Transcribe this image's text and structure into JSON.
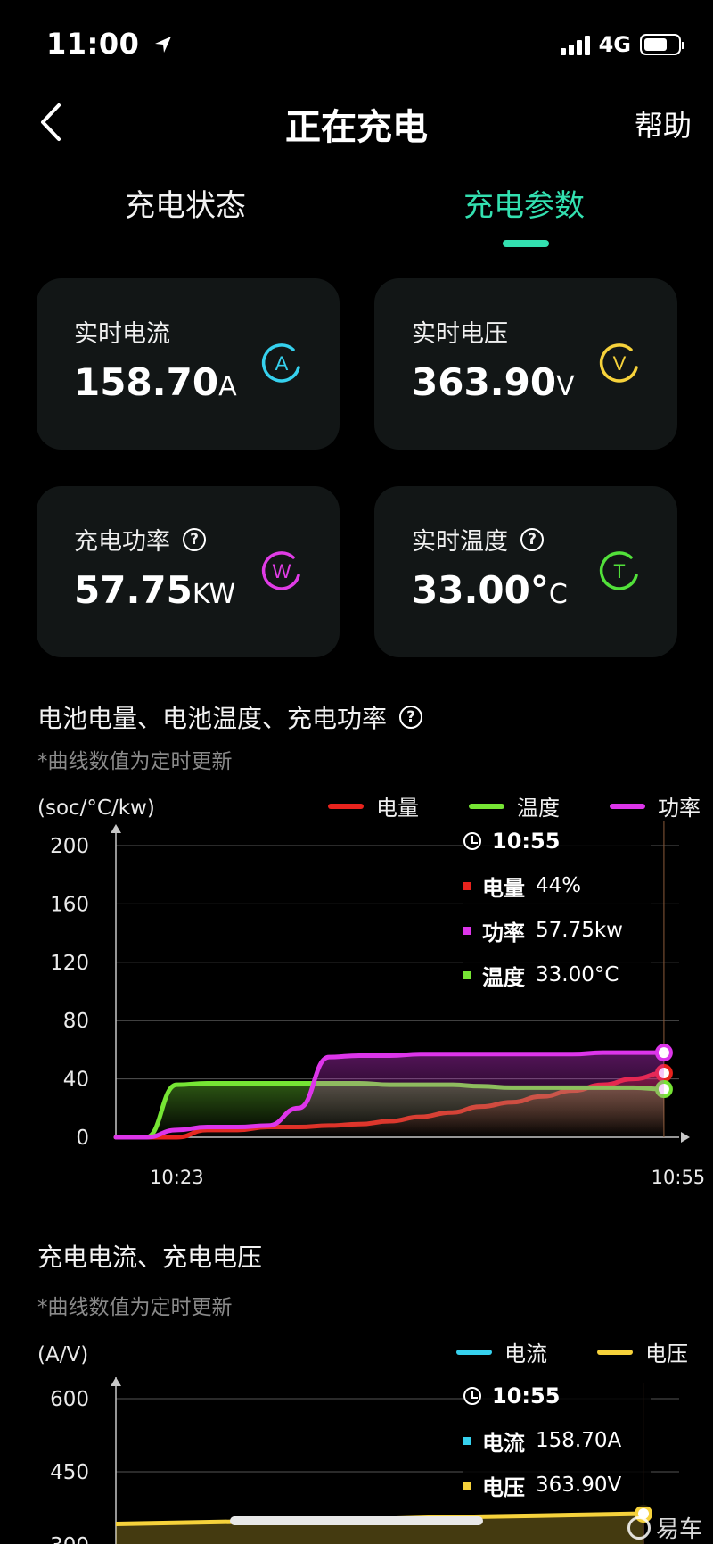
{
  "status_bar": {
    "time": "11:00",
    "network": "4G"
  },
  "nav": {
    "title": "正在充电",
    "help": "帮助"
  },
  "tabs": [
    {
      "label": "充电状态",
      "active": false
    },
    {
      "label": "充电参数",
      "active": true
    }
  ],
  "cards": {
    "current": {
      "label": "实时电流",
      "value": "158.70",
      "unit": "A",
      "icon_letter": "A",
      "icon_color": "#36d1ee"
    },
    "voltage": {
      "label": "实时电压",
      "value": "363.90",
      "unit": "V",
      "icon_letter": "V",
      "icon_color": "#f6d23b"
    },
    "power": {
      "label": "充电功率",
      "value": "57.75",
      "unit": "KW",
      "icon_letter": "W",
      "icon_color": "#e03ce6"
    },
    "temp": {
      "label": "实时温度",
      "value": "33.00°",
      "unit": "C",
      "icon_letter": "T",
      "icon_color": "#52e13a"
    }
  },
  "section1": {
    "title": "电池电量、电池温度、充电功率",
    "note": "*曲线数值为定时更新"
  },
  "section2": {
    "title": "充电电流、充电电压",
    "note": "*曲线数值为定时更新"
  },
  "chart1": {
    "unit_label": "(soc/°C/kw)",
    "legend": [
      {
        "name": "电量",
        "color": "#e8231d"
      },
      {
        "name": "温度",
        "color": "#76e534"
      },
      {
        "name": "功率",
        "color": "#dd35ea"
      }
    ],
    "tooltip": {
      "time": "10:55",
      "rows": [
        {
          "name": "电量",
          "value": "44%",
          "color": "#e8231d"
        },
        {
          "name": "功率",
          "value": "57.75kw",
          "color": "#dd35ea"
        },
        {
          "name": "温度",
          "value": "33.00°C",
          "color": "#76e534"
        }
      ]
    },
    "x_tick_labels": [
      "10:23",
      "10:55"
    ],
    "y_tick_labels": [
      "200",
      "160",
      "120",
      "80",
      "40",
      "0"
    ]
  },
  "chart2": {
    "unit_label": "(A/V)",
    "legend": [
      {
        "name": "电流",
        "color": "#36d1ee"
      },
      {
        "name": "电压",
        "color": "#f6d23b"
      }
    ],
    "tooltip": {
      "time": "10:55",
      "rows": [
        {
          "name": "电流",
          "value": "158.70A",
          "color": "#36d1ee"
        },
        {
          "name": "电压",
          "value": "363.90V",
          "color": "#f6d23b"
        }
      ]
    },
    "y_tick_labels": [
      "600",
      "450",
      "300"
    ]
  },
  "chart_data": [
    {
      "type": "line",
      "title": "电池电量、电池温度、充电功率",
      "ylabel": "(soc/°C/kw)",
      "x": [
        "10:19",
        "10:21",
        "10:23",
        "10:25",
        "10:27",
        "10:29",
        "10:31",
        "10:33",
        "10:35",
        "10:37",
        "10:39",
        "10:41",
        "10:43",
        "10:45",
        "10:47",
        "10:49",
        "10:51",
        "10:53",
        "10:55"
      ],
      "xlim": [
        "10:19",
        "10:56"
      ],
      "ylim": [
        0,
        200
      ],
      "yticks": [
        0,
        40,
        80,
        120,
        160,
        200
      ],
      "series": [
        {
          "name": "电量",
          "color": "#e8231d",
          "values": [
            0,
            0,
            0,
            5,
            5,
            7,
            7,
            8,
            9,
            11,
            14,
            17,
            21,
            24,
            28,
            32,
            36,
            40,
            44
          ]
        },
        {
          "name": "温度",
          "color": "#76e534",
          "values": [
            0,
            0,
            36,
            37,
            37,
            37,
            37,
            37,
            37,
            36,
            36,
            36,
            35,
            34,
            34,
            34,
            34,
            34,
            33
          ]
        },
        {
          "name": "功率",
          "color": "#dd35ea",
          "values": [
            0,
            0,
            5,
            7,
            7,
            8,
            20,
            55,
            56,
            56,
            57,
            57,
            57,
            57,
            57,
            57,
            58,
            58,
            58
          ]
        }
      ]
    },
    {
      "type": "line",
      "title": "充电电流、充电电压",
      "ylabel": "(A/V)",
      "ylim": [
        300,
        600
      ],
      "yticks": [
        300,
        450,
        600
      ],
      "series": [
        {
          "name": "电压",
          "color": "#f6d23b",
          "values": [
            343,
            345,
            347,
            349,
            351,
            353,
            356,
            358,
            360,
            362,
            364
          ]
        }
      ]
    }
  ]
}
